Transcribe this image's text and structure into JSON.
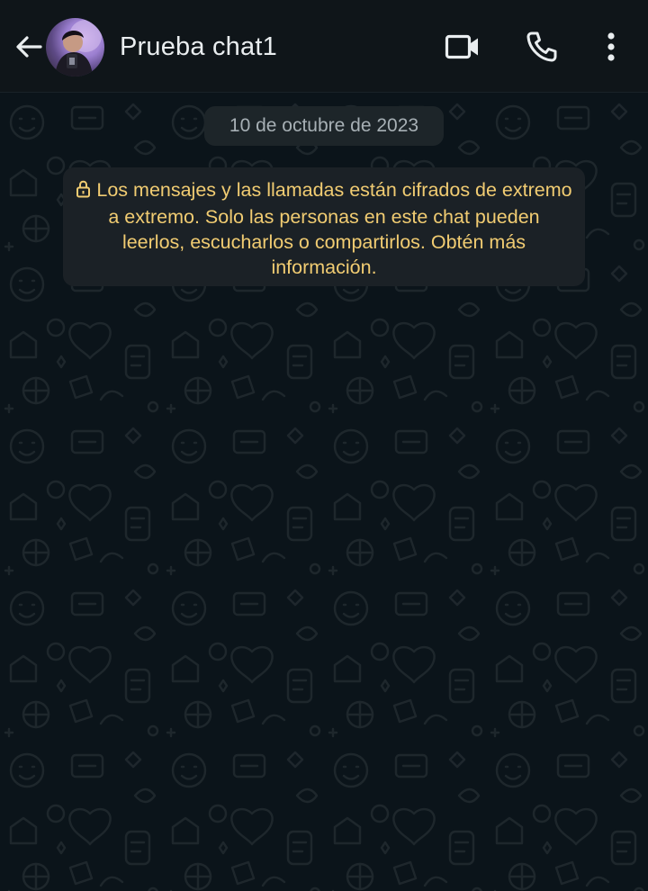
{
  "header": {
    "contact_name": "Prueba chat1",
    "icons": {
      "back": "back-arrow-icon",
      "video": "video-camera-icon",
      "call": "phone-icon",
      "menu": "more-vertical-icon"
    }
  },
  "chat": {
    "date_label": "10 de octubre de 2023",
    "encryption_notice": "Los mensajes y las llamadas están cifrados de extremo a extremo. Solo las personas en este chat pueden leerlos, escucharlos o compartirlos. Obtén más información.",
    "notice_icon": "lock-icon"
  },
  "colors": {
    "background": "#0b141a",
    "header_bg": "#0f1519",
    "chip_bg": "#1d2529",
    "notice_text": "#f1cc72",
    "primary_text": "#e9edef"
  }
}
